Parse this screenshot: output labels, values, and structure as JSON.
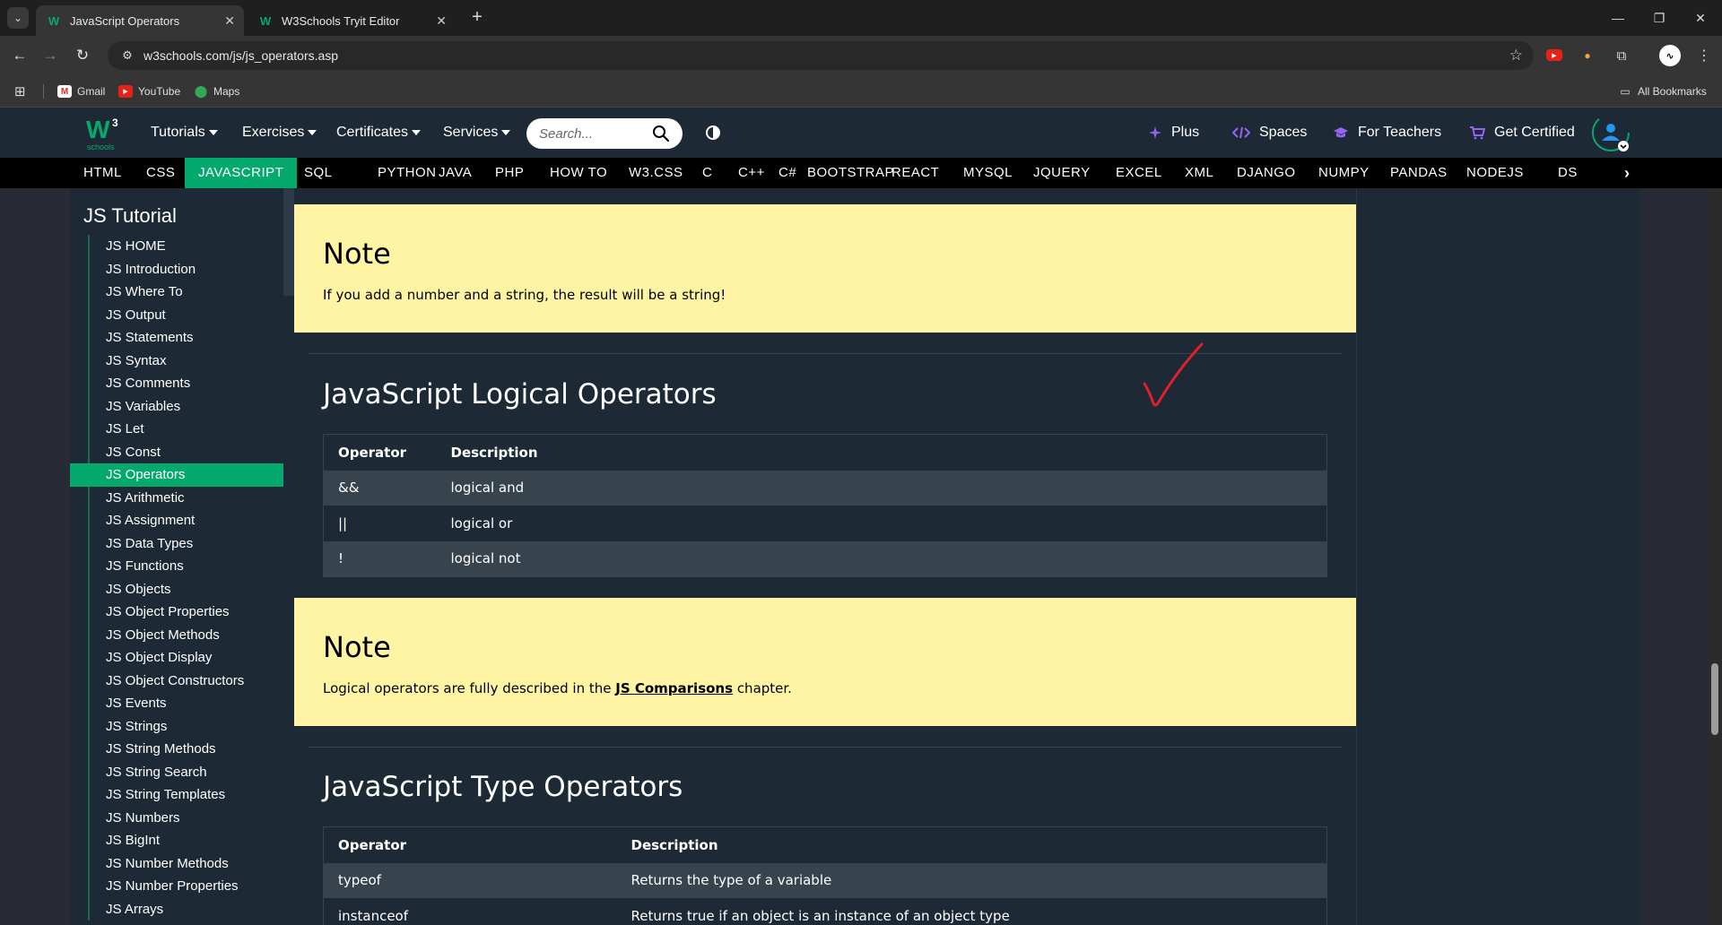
{
  "browser": {
    "tabs": [
      {
        "title": "JavaScript Operators",
        "active": true
      },
      {
        "title": "W3Schools Tryit Editor",
        "active": false
      }
    ],
    "url": "w3schools.com/js/js_operators.asp",
    "bookmarks": [
      "Gmail",
      "YouTube",
      "Maps"
    ],
    "all_bookmarks": "All Bookmarks"
  },
  "w3": {
    "logo_sub": "schools",
    "menu": [
      "Tutorials",
      "Exercises",
      "Certificates",
      "Services"
    ],
    "search_placeholder": "Search...",
    "right_links": [
      "Plus",
      "Spaces",
      "For Teachers",
      "Get Certified"
    ],
    "subjects": [
      "HTML",
      "CSS",
      "JAVASCRIPT",
      "SQL",
      "PYTHON",
      "JAVA",
      "PHP",
      "HOW TO",
      "W3.CSS",
      "C",
      "C++",
      "C#",
      "BOOTSTRAP",
      "REACT",
      "MYSQL",
      "JQUERY",
      "EXCEL",
      "XML",
      "DJANGO",
      "NUMPY",
      "PANDAS",
      "NODEJS",
      "DS"
    ],
    "active_subject": "JAVASCRIPT"
  },
  "sidebar": {
    "title": "JS Tutorial",
    "items": [
      "JS HOME",
      "JS Introduction",
      "JS Where To",
      "JS Output",
      "JS Statements",
      "JS Syntax",
      "JS Comments",
      "JS Variables",
      "JS Let",
      "JS Const",
      "JS Operators",
      "JS Arithmetic",
      "JS Assignment",
      "JS Data Types",
      "JS Functions",
      "JS Objects",
      "JS Object Properties",
      "JS Object Methods",
      "JS Object Display",
      "JS Object Constructors",
      "JS Events",
      "JS Strings",
      "JS String Methods",
      "JS String Search",
      "JS String Templates",
      "JS Numbers",
      "JS BigInt",
      "JS Number Methods",
      "JS Number Properties",
      "JS Arrays"
    ],
    "active_item": "JS Operators"
  },
  "main": {
    "note1": {
      "title": "Note",
      "text": "If you add a number and a string, the result will be a string!"
    },
    "logical": {
      "title": "JavaScript Logical Operators",
      "headers": [
        "Operator",
        "Description"
      ],
      "rows": [
        [
          "&&",
          "logical and"
        ],
        [
          "||",
          "logical or"
        ],
        [
          "!",
          "logical not"
        ]
      ]
    },
    "note2": {
      "title": "Note",
      "text_before": "Logical operators are fully described in the ",
      "link": "JS Comparisons",
      "text_after": " chapter."
    },
    "type_ops": {
      "title": "JavaScript Type Operators",
      "headers": [
        "Operator",
        "Description"
      ],
      "rows": [
        [
          "typeof",
          "Returns the type of a variable"
        ],
        [
          "instanceof",
          "Returns true if an object is an instance of an object type"
        ]
      ]
    }
  },
  "colors": {
    "accent": "#04aa6d",
    "note_bg": "#fff4a3",
    "page_bg": "#1d2a35",
    "row_alt": "#38444d",
    "annotation": "#e0202b"
  }
}
